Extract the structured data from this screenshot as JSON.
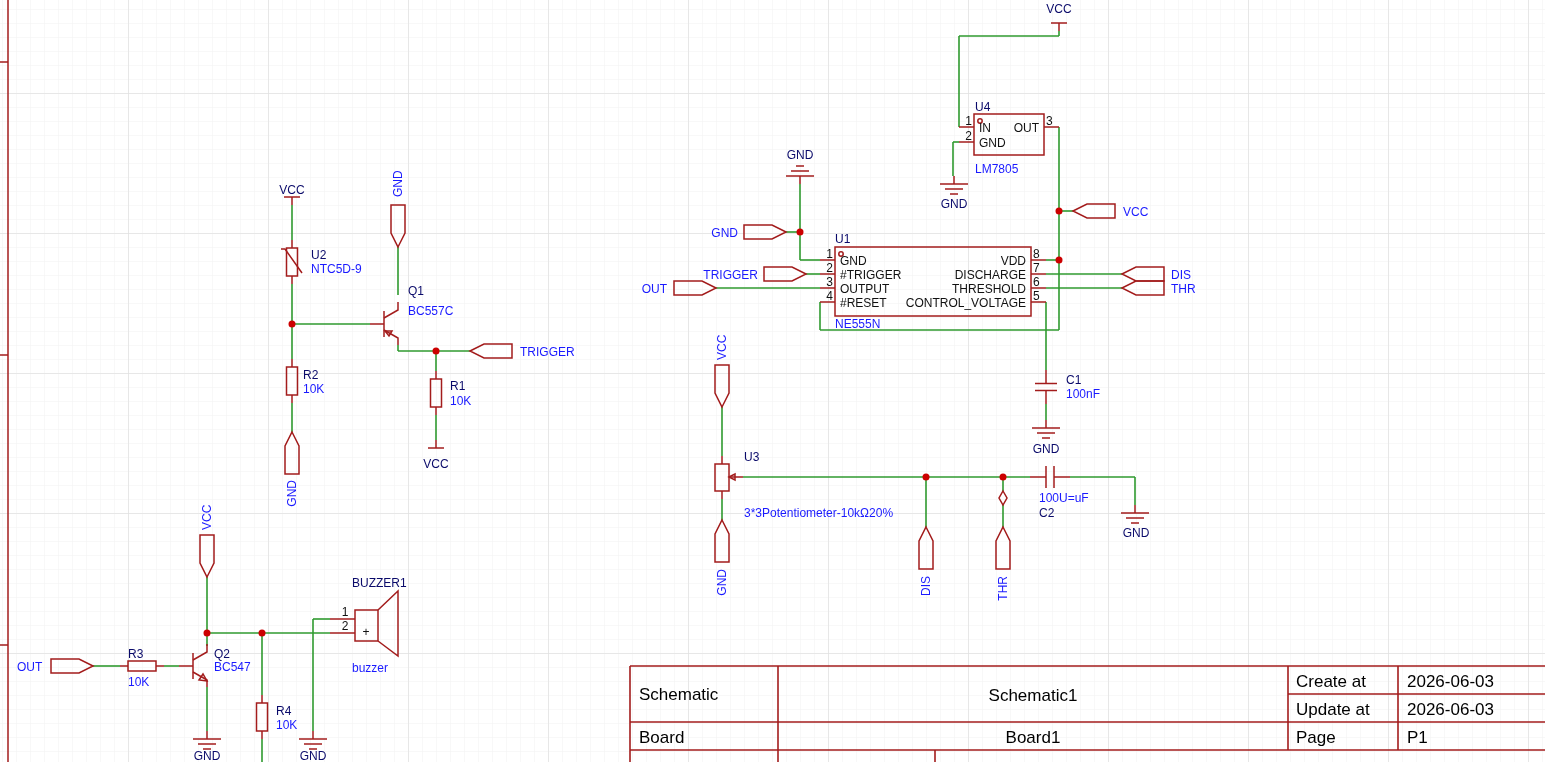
{
  "components": [
    {
      "kind": "ntc",
      "designator": "U2",
      "value": "NTC5D-9"
    },
    {
      "kind": "pnp",
      "designator": "Q1",
      "value": "BC557C"
    },
    {
      "kind": "resistor",
      "designator": "R2",
      "value": "10K"
    },
    {
      "kind": "resistor",
      "designator": "R1",
      "value": "10K"
    },
    {
      "kind": "resistor",
      "designator": "R3",
      "value": "10K"
    },
    {
      "kind": "npn",
      "designator": "Q2",
      "value": "BC547"
    },
    {
      "kind": "resistor",
      "designator": "R4",
      "value": "10K"
    },
    {
      "kind": "buzzer",
      "designator": "BUZZER1",
      "value": "buzzer",
      "polarity": "+",
      "pins": [
        {
          "number": "1"
        },
        {
          "number": "2"
        }
      ]
    },
    {
      "kind": "ic",
      "designator": "U4",
      "value": "LM7805",
      "pins": [
        {
          "number": "1",
          "name": "IN"
        },
        {
          "number": "2",
          "name": "GND"
        },
        {
          "number": "3",
          "name": "OUT"
        }
      ]
    },
    {
      "kind": "ic",
      "designator": "U1",
      "value": "NE555N",
      "pins": [
        {
          "number": "1",
          "name": "GND"
        },
        {
          "number": "2",
          "name": "#TRIGGER"
        },
        {
          "number": "3",
          "name": "OUTPUT"
        },
        {
          "number": "4",
          "name": "#RESET"
        },
        {
          "number": "8",
          "name": "VDD"
        },
        {
          "number": "7",
          "name": "DISCHARGE"
        },
        {
          "number": "6",
          "name": "THRESHOLD"
        },
        {
          "number": "5",
          "name": "CONTROL_VOLTAGE"
        }
      ]
    },
    {
      "kind": "capacitor",
      "designator": "C1",
      "value": "100nF"
    },
    {
      "kind": "potentiometer",
      "designator": "U3",
      "value": "3*3Potentiometer-10kΩ20%"
    },
    {
      "kind": "capacitor",
      "designator": "C2",
      "value": "100U=uF"
    }
  ],
  "power_symbols": [
    {
      "kind": "vcc",
      "label": "VCC"
    },
    {
      "kind": "vcc",
      "label": "VCC"
    },
    {
      "kind": "gnd",
      "label": "GND"
    },
    {
      "kind": "gnd",
      "label": "GND"
    },
    {
      "kind": "vcc",
      "label": "VCC"
    },
    {
      "kind": "gnd",
      "label": "GND"
    },
    {
      "kind": "gnd",
      "label": "GND"
    },
    {
      "kind": "gnd",
      "label": "GND"
    },
    {
      "kind": "gnd",
      "label": "GND"
    }
  ],
  "net_ports": [
    {
      "label": "GND"
    },
    {
      "label": "GND"
    },
    {
      "label": "TRIGGER"
    },
    {
      "label": "VCC"
    },
    {
      "label": "OUT"
    },
    {
      "label": "GND"
    },
    {
      "label": "TRIGGER"
    },
    {
      "label": "OUT"
    },
    {
      "label": "VCC"
    },
    {
      "label": "DIS"
    },
    {
      "label": "THR"
    },
    {
      "label": "VCC"
    },
    {
      "label": "GND"
    },
    {
      "label": "DIS"
    },
    {
      "label": "THR"
    }
  ],
  "title_block": {
    "sheet_label": "Schematic",
    "sheet_name": "Schematic1",
    "board_label": "Board",
    "board_name": "Board1",
    "dates": [
      {
        "label": "Create at",
        "value": "2026-06-03"
      },
      {
        "label": "Update at",
        "value": "2026-06-03"
      }
    ],
    "page_label": "Page",
    "page": "P1"
  }
}
